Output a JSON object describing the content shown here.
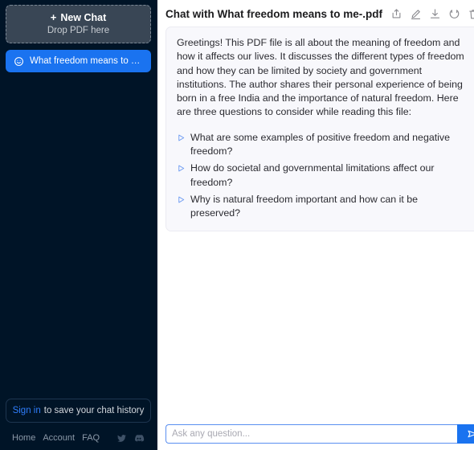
{
  "sidebar": {
    "new_chat": {
      "plus": "+",
      "label": "New Chat",
      "subtitle": "Drop PDF here"
    },
    "chats": [
      {
        "icon": "chat-bubble-icon",
        "label": "What freedom means to me-..."
      }
    ],
    "signin": {
      "link_label": "Sign in",
      "rest_label": "to save your chat history"
    },
    "footer": {
      "links": [
        "Home",
        "Account",
        "FAQ"
      ],
      "socials": [
        "twitter-icon",
        "discord-icon"
      ]
    }
  },
  "main": {
    "header": {
      "title": "Chat with What freedom means to me-.pdf",
      "actions": [
        {
          "name": "share-icon",
          "title": "Share"
        },
        {
          "name": "edit-icon",
          "title": "Edit"
        },
        {
          "name": "download-icon",
          "title": "Download"
        },
        {
          "name": "regenerate-icon",
          "title": "Regenerate"
        },
        {
          "name": "delete-icon",
          "title": "Delete"
        }
      ]
    },
    "message": {
      "body": "Greetings! This PDF file is all about the meaning of freedom and how it affects our lives. It discusses the different types of freedom and how they can be limited by society and government institutions. The author shares their personal experience of being born in a free India and the importance of natural freedom. Here are three questions to consider while reading this file:",
      "questions": [
        "What are some examples of positive freedom and negative freedom?",
        "How do societal and governmental limitations affect our freedom?",
        "Why is natural freedom important and how can it be preserved?"
      ]
    },
    "composer": {
      "placeholder": "Ask any question...",
      "value": "",
      "send_icon": "send-icon"
    }
  },
  "colors": {
    "sidebar_bg": "#001427",
    "accent_blue": "#1a73f0",
    "new_chat_bg": "#394655",
    "bubble_bg": "#f8f8fc",
    "link_blue": "#2f7dfb"
  }
}
